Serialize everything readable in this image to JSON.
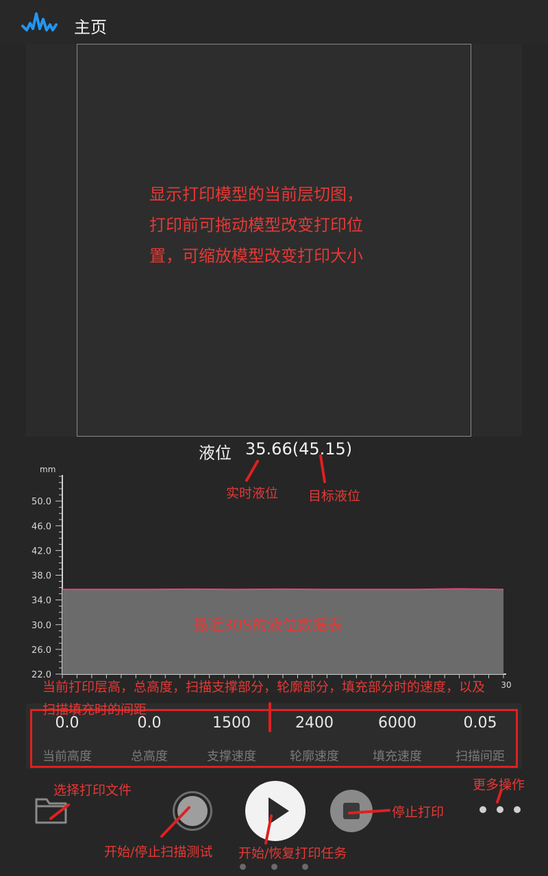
{
  "header": {
    "title": "主页",
    "logo_icon": "waveform-logo-icon"
  },
  "preview": {
    "note_lines": [
      "显示打印模型的当前层切图，",
      "打印前可拖动模型改变打印位",
      "置，可缩放模型改变打印大小"
    ]
  },
  "level": {
    "label": "液位",
    "value": "35.66(45.15)",
    "annotation_realtime": "实时液位",
    "annotation_target": "目标液位"
  },
  "chart_data": {
    "type": "area",
    "ylabel": "mm",
    "ylim": [
      22,
      54
    ],
    "y_ticks": [
      "22.0",
      "26.0",
      "30.0",
      "34.0",
      "38.0",
      "42.0",
      "46.0",
      "50.0"
    ],
    "x_tick_last": "30",
    "xlim": [
      0,
      30
    ],
    "series": [
      {
        "x": [
          0,
          3,
          6,
          9,
          12,
          15,
          18,
          21,
          24,
          27,
          30
        ],
        "values": [
          35.7,
          35.7,
          35.7,
          35.75,
          35.7,
          35.75,
          35.7,
          35.7,
          35.7,
          35.8,
          35.7
        ]
      }
    ],
    "line_color": "#e0487a",
    "fill_color": "#6b6b6b",
    "annotation": "最近30S的液位数据表"
  },
  "params": {
    "banner_lines": [
      "当前打印层高，总高度，扫描支撑部分，轮廓部分，填充部分时的速度，以及",
      "扫描填充时的间距"
    ],
    "items": [
      {
        "value": "0.0",
        "label": "当前高度"
      },
      {
        "value": "0.0",
        "label": "总高度"
      },
      {
        "value": "1500",
        "label": "支撑速度"
      },
      {
        "value": "2400",
        "label": "轮廓速度"
      },
      {
        "value": "6000",
        "label": "填充速度"
      },
      {
        "value": "0.05",
        "label": "扫描间距"
      }
    ]
  },
  "actions": {
    "select_file": "选择打印文件",
    "scan_test": "开始/停止扫描测试",
    "start_resume": "开始/恢复打印任务",
    "stop": "停止打印",
    "more": "更多操作",
    "icons": [
      "folder-icon",
      "scan-circle-icon",
      "play-icon",
      "stop-icon",
      "more-dots-icon"
    ]
  },
  "colors": {
    "accent_blue": "#2196f3",
    "annotation_red": "#e53935",
    "background": "#262626"
  }
}
